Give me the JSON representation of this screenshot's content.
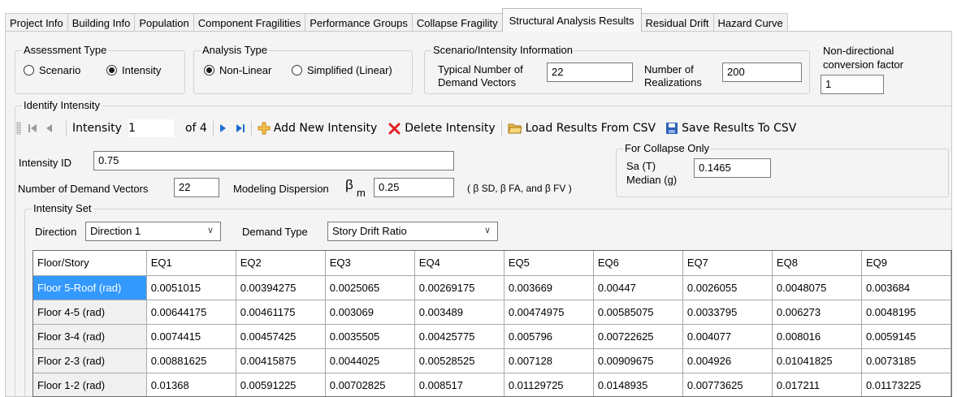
{
  "tabs": [
    {
      "label": "Project Info"
    },
    {
      "label": "Building Info"
    },
    {
      "label": "Population"
    },
    {
      "label": "Component Fragilities"
    },
    {
      "label": "Performance Groups"
    },
    {
      "label": "Collapse Fragility"
    },
    {
      "label": "Structural Analysis Results",
      "active": true
    },
    {
      "label": "Residual Drift"
    },
    {
      "label": "Hazard Curve"
    }
  ],
  "assessment_type": {
    "legend": "Assessment Type",
    "options": [
      "Scenario",
      "Intensity"
    ],
    "selected": "Intensity"
  },
  "analysis_type": {
    "legend": "Analysis Type",
    "options": [
      "Non-Linear",
      "Simplified (Linear)"
    ],
    "selected": "Non-Linear"
  },
  "scenario_info": {
    "legend": "Scenario/Intensity Information",
    "typical_label_1": "Typical Number of",
    "typical_label_2": "Demand Vectors",
    "typical_value": "22",
    "realizations_label_1": "Number of",
    "realizations_label_2": "Realizations",
    "realizations_value": "200"
  },
  "conversion": {
    "label_1": "Non-directional",
    "label_2": "conversion factor",
    "value": "1"
  },
  "identify_intensity": {
    "legend": "Identify Intensity"
  },
  "toolbar": {
    "intensity_label": "Intensity",
    "intensity_value": "1",
    "of_text": "of 4",
    "add_label": "Add New Intensity",
    "delete_label": "Delete Intensity",
    "load_label": "Load Results From CSV",
    "save_label": "Save Results To CSV"
  },
  "intensity": {
    "id_label": "Intensity ID",
    "id_value": "0.75",
    "num_vectors_label": "Number of Demand Vectors",
    "num_vectors_value": "22",
    "dispersion_label": "Modeling Dispersion",
    "beta_symbol": "β",
    "beta_sub": "m",
    "dispersion_value": "0.25",
    "dispersion_note": "( β SD, β FA, and β FV )"
  },
  "collapse": {
    "legend": "For Collapse Only",
    "sa_label": "Sa (T)",
    "median_label": "Median (g)",
    "value": "0.1465"
  },
  "intensity_set": {
    "legend": "Intensity Set",
    "direction_label": "Direction",
    "direction_value": "Direction 1",
    "demand_label": "Demand Type",
    "demand_value": "Story Drift Ratio"
  },
  "grid": {
    "headers": [
      "Floor/Story",
      "EQ1",
      "EQ2",
      "EQ3",
      "EQ4",
      "EQ5",
      "EQ6",
      "EQ7",
      "EQ8",
      "EQ9"
    ],
    "rows": [
      [
        "Floor 5-Roof (rad)",
        "0.0051015",
        "0.00394275",
        "0.0025065",
        "0.00269175",
        "0.003669",
        "0.00447",
        "0.0026055",
        "0.0048075",
        "0.003684"
      ],
      [
        "Floor 4-5 (rad)",
        "0.00644175",
        "0.00461175",
        "0.003069",
        "0.003489",
        "0.00474975",
        "0.00585075",
        "0.0033795",
        "0.006273",
        "0.0048195"
      ],
      [
        "Floor 3-4 (rad)",
        "0.0074415",
        "0.00457425",
        "0.0035505",
        "0.00425775",
        "0.005796",
        "0.00722625",
        "0.004077",
        "0.008016",
        "0.0059145"
      ],
      [
        "Floor 2-3 (rad)",
        "0.00881625",
        "0.00415875",
        "0.0044025",
        "0.00528525",
        "0.007128",
        "0.00909675",
        "0.004926",
        "0.01041825",
        "0.0073185"
      ],
      [
        "Floor 1-2 (rad)",
        "0.01368",
        "0.00591225",
        "0.00702825",
        "0.008517",
        "0.01129725",
        "0.0148935",
        "0.00773625",
        "0.017211",
        "0.01173225"
      ]
    ],
    "selected_row": 0
  },
  "colors": {
    "selection": "#3399ff",
    "nav_blue": "#1f6fd0",
    "add_icon": "#e8a317",
    "delete_icon": "#e02020"
  },
  "icons": [
    "grip-icon",
    "first-record-icon",
    "prev-record-icon",
    "next-record-icon",
    "last-record-icon",
    "add-icon",
    "delete-icon",
    "folder-open-icon",
    "save-disk-icon",
    "chevron-down-icon"
  ]
}
